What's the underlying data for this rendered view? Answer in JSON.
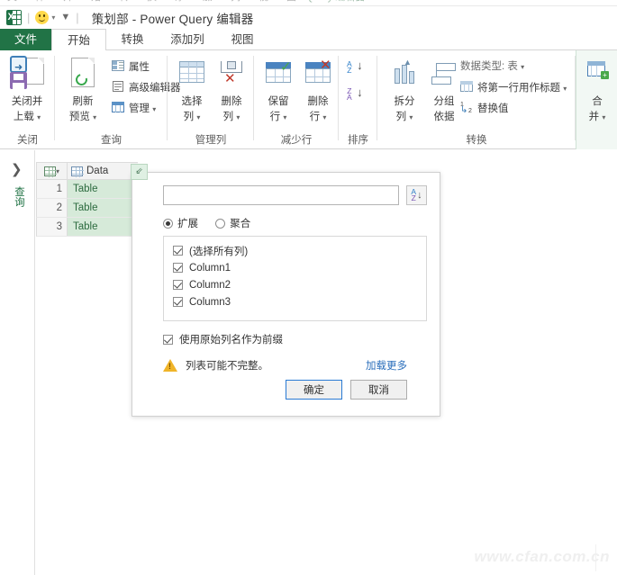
{
  "window": {
    "app_icon": "excel-icon",
    "quick_access": [
      {
        "name": "autosave-smiley-icon",
        "label": ""
      },
      {
        "name": "save-icon",
        "label": ""
      },
      {
        "name": "customize-qat-caret-icon",
        "label": ""
      }
    ],
    "title": "策划部 - Power Query 编辑器"
  },
  "tabs": [
    {
      "id": "file",
      "label": "文件"
    },
    {
      "id": "home",
      "label": "开始"
    },
    {
      "id": "transform",
      "label": "转换"
    },
    {
      "id": "addcolumn",
      "label": "添加列"
    },
    {
      "id": "view",
      "label": "视图"
    }
  ],
  "ribbon": {
    "groups": [
      {
        "id": "close",
        "label": "关闭",
        "buttons": [
          {
            "id": "close-and-load",
            "line1": "关闭并",
            "line2": "上载",
            "caret": "▾"
          }
        ]
      },
      {
        "id": "query",
        "label": "查询",
        "buttons": [
          {
            "id": "refresh-preview",
            "line1": "刷新",
            "line2": "预览",
            "caret": "▾"
          }
        ],
        "small": [
          {
            "id": "properties",
            "label": "属性",
            "icon": "properties-icon"
          },
          {
            "id": "advanced-editor",
            "label": "高级编辑器",
            "icon": "advanced-editor-icon"
          },
          {
            "id": "manage",
            "label": "管理",
            "icon": "manage-icon",
            "caret": "▾"
          }
        ]
      },
      {
        "id": "manage-columns",
        "label": "管理列",
        "buttons": [
          {
            "id": "choose-columns",
            "line1": "选择",
            "line2": "列",
            "caret": "▾"
          },
          {
            "id": "remove-columns",
            "line1": "删除",
            "line2": "列",
            "caret": "▾"
          }
        ]
      },
      {
        "id": "reduce-rows",
        "label": "减少行",
        "buttons": [
          {
            "id": "keep-rows",
            "line1": "保留",
            "line2": "行",
            "caret": "▾"
          },
          {
            "id": "remove-rows",
            "line1": "删除",
            "line2": "行",
            "caret": "▾"
          }
        ]
      },
      {
        "id": "sort",
        "label": "排序",
        "buttons": [
          {
            "id": "sort-ascending",
            "line1": "",
            "line2": "",
            "caret": ""
          },
          {
            "id": "sort-descending",
            "line1": "",
            "line2": "",
            "caret": ""
          }
        ]
      },
      {
        "id": "transform-group",
        "label": "转换",
        "buttons": [
          {
            "id": "split-column",
            "line1": "拆分",
            "line2": "列",
            "caret": "▾"
          },
          {
            "id": "group-by",
            "line1": "分组",
            "line2": "依据",
            "caret": ""
          }
        ],
        "small": [
          {
            "id": "data-type",
            "label": "数据类型: 表",
            "icon": "data-type-icon",
            "caret": "▾"
          },
          {
            "id": "use-first-row-as-headers",
            "label": "将第一行用作标题",
            "icon": "headers-icon",
            "caret": "▾"
          },
          {
            "id": "replace-values",
            "label": "替换值",
            "icon": "replace-values-icon"
          }
        ]
      },
      {
        "id": "combine",
        "label": "",
        "buttons": [
          {
            "id": "combine",
            "line1": "合",
            "line2": "并",
            "caret": "▾"
          }
        ]
      }
    ]
  },
  "left_rail": {
    "expand_icon": "chevron-right-icon",
    "label": "查询"
  },
  "grid": {
    "column_header": "Data",
    "expand_button_icon": "expand-columns-icon",
    "rows": [
      {
        "number": "1",
        "value": "Table"
      },
      {
        "number": "2",
        "value": "Table"
      },
      {
        "number": "3",
        "value": "Table"
      }
    ]
  },
  "dialog": {
    "search": {
      "value": "",
      "placeholder": ""
    },
    "sort_button": {
      "icon": "sort-az-icon",
      "a": "A",
      "z": "Z",
      "arrow": "↓"
    },
    "modes": [
      {
        "id": "expand",
        "label": "扩展",
        "selected": true
      },
      {
        "id": "aggregate",
        "label": "聚合",
        "selected": false
      }
    ],
    "columns": [
      {
        "id": "select-all",
        "label": "(选择所有列)",
        "checked": true
      },
      {
        "id": "column1",
        "label": "Column1",
        "checked": true
      },
      {
        "id": "column2",
        "label": "Column2",
        "checked": true
      },
      {
        "id": "column3",
        "label": "Column3",
        "checked": true
      }
    ],
    "prefix_option": {
      "label": "使用原始列名作为前缀",
      "checked": true
    },
    "warning": {
      "icon": "warning-icon",
      "text": "列表可能不完整。"
    },
    "load_more": "加载更多",
    "buttons": {
      "ok": "确定",
      "cancel": "取消"
    }
  },
  "watermark": "www.cfan.com.cn",
  "colors": {
    "excel_green": "#217346",
    "cell_green": "#d6ead9",
    "accent_blue": "#2a6ebb",
    "warning_amber": "#f0b429"
  }
}
